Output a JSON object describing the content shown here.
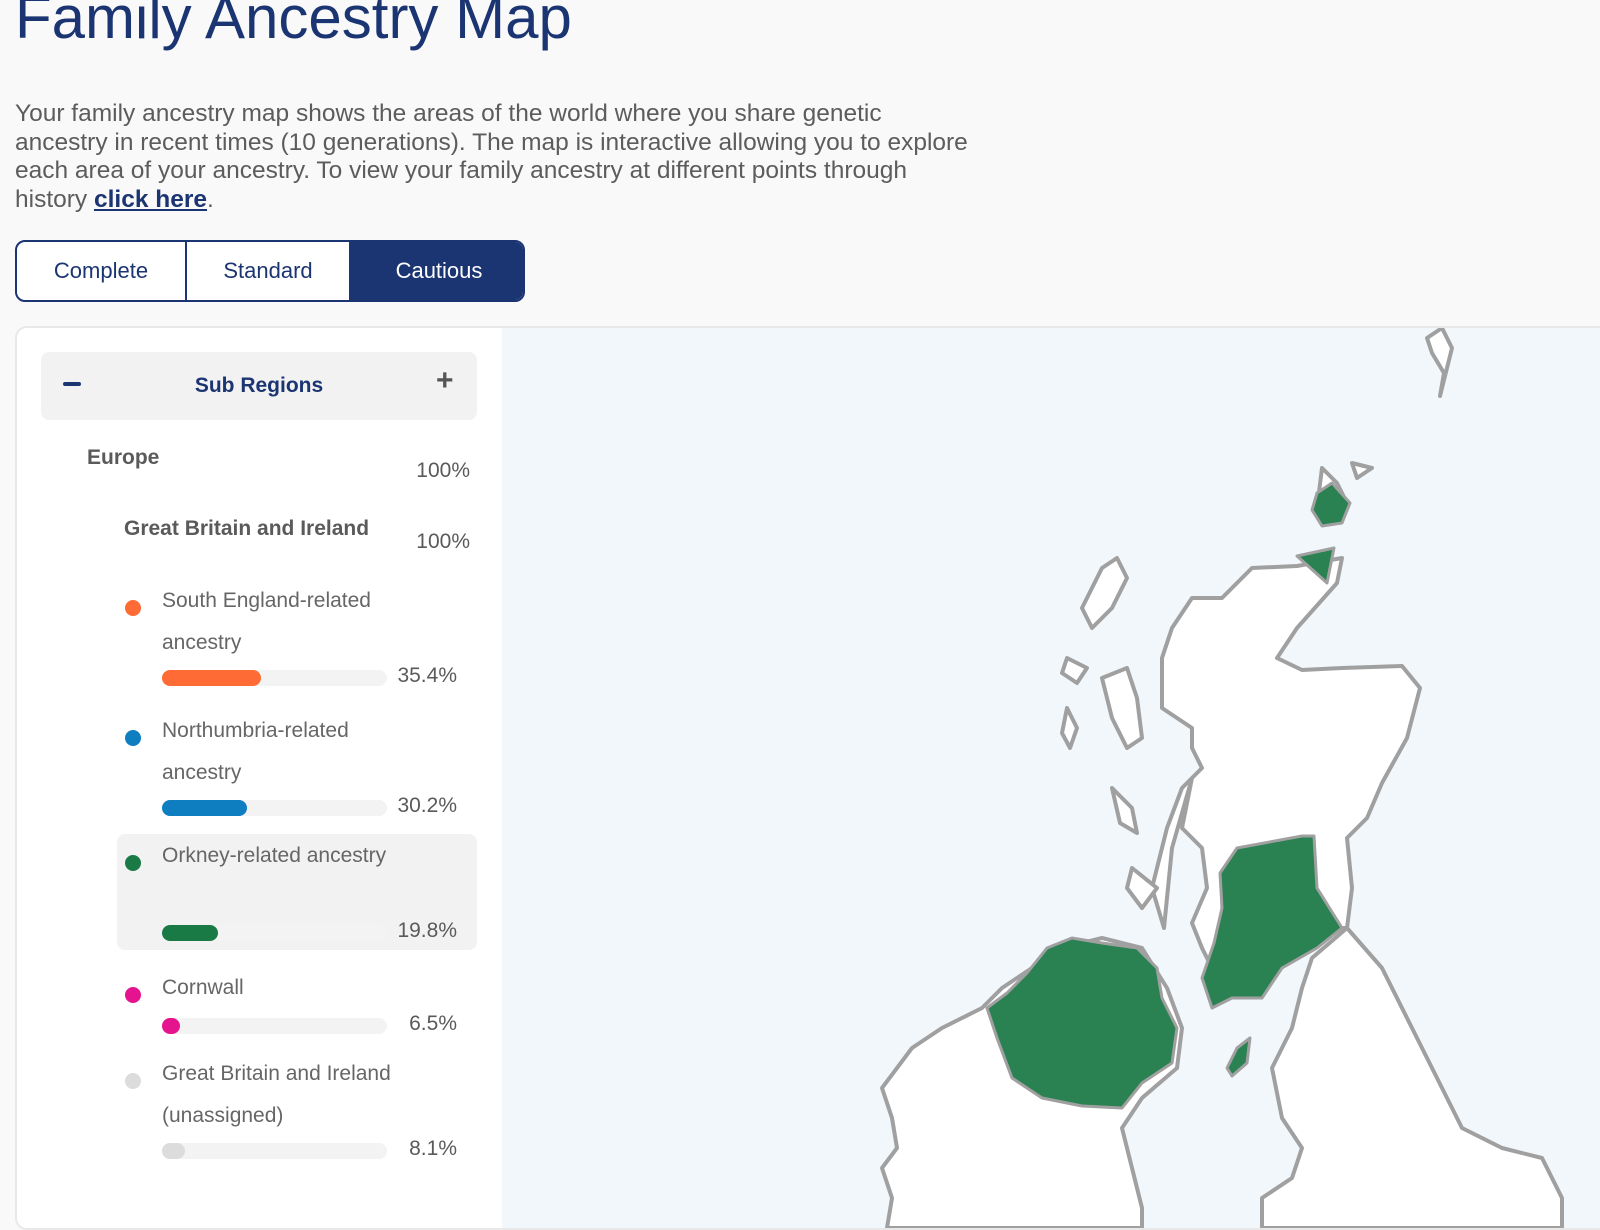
{
  "page": {
    "title": "Family Ancestry Map",
    "intro_text": "Your family ancestry map shows the areas of the world where you share genetic ancestry in recent times (10 generations). The map is interactive allowing you to explore each area of your ancestry. To view your family ancestry at different points through history ",
    "intro_link": "click here",
    "intro_end": "."
  },
  "tabs": [
    {
      "label": "Complete",
      "active": false
    },
    {
      "label": "Standard",
      "active": false
    },
    {
      "label": "Cautious",
      "active": true
    }
  ],
  "sidebar": {
    "header": {
      "title": "Sub Regions",
      "collapse_icon": "minus-icon",
      "expand_icon": "plus-icon"
    },
    "region": {
      "name": "Europe",
      "percent": "100%"
    },
    "subregion": {
      "name": "Great Britain and Ireland",
      "percent": "100%"
    },
    "items": [
      {
        "name": "South England-related ancestry",
        "percent": "35.4%",
        "value": 35.4,
        "color": "#ff6b35",
        "highlighted": false
      },
      {
        "name": "Northumbria-related ancestry",
        "percent": "30.2%",
        "value": 30.2,
        "color": "#0f7ec1",
        "highlighted": false
      },
      {
        "name": "Orkney-related ancestry",
        "percent": "19.8%",
        "value": 19.8,
        "color": "#1a7a45",
        "highlighted": true
      },
      {
        "name": "Cornwall",
        "percent": "6.5%",
        "value": 6.5,
        "color": "#e6138f",
        "highlighted": false
      },
      {
        "name": "Great Britain and Ireland (unassigned)",
        "percent": "8.1%",
        "value": 8.1,
        "color": "#dcdcdc",
        "highlighted": false
      }
    ]
  },
  "map": {
    "land_color": "#ffffff",
    "border_color": "#a0a0a0",
    "highlight_color": "#2a8152",
    "water_color": "#f1f7fb"
  }
}
